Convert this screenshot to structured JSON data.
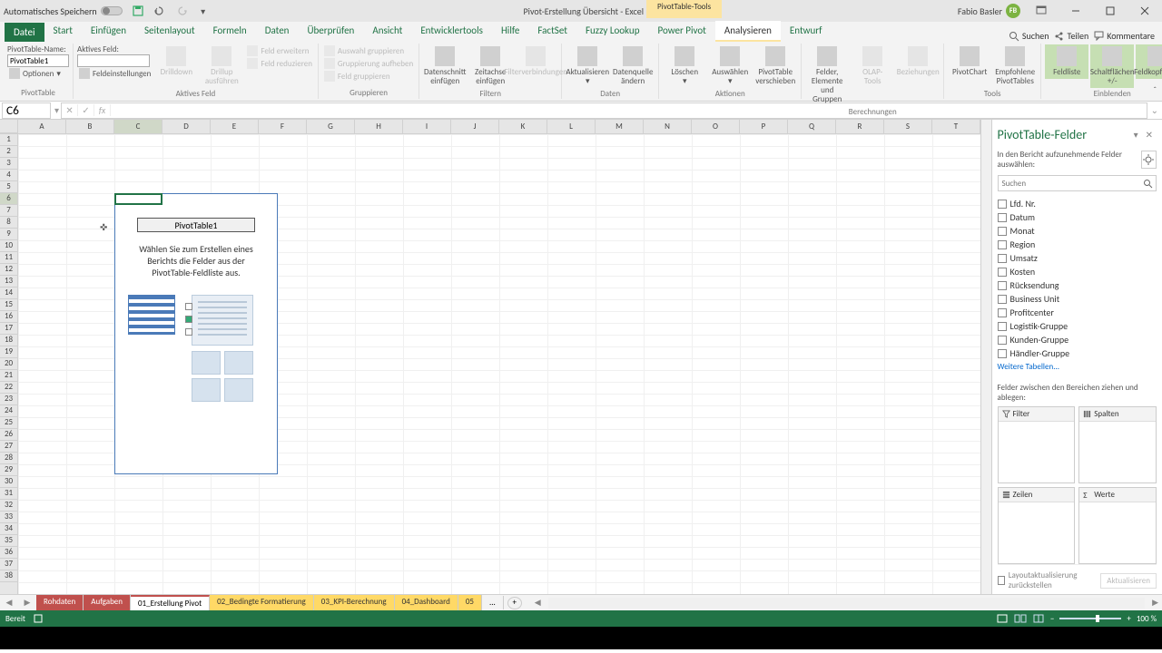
{
  "titlebar": {
    "autosave": "Automatisches Speichern",
    "document_title": "Pivot-Erstellung Übersicht  -  Excel",
    "contextual_tab": "PivotTable-Tools",
    "user_name": "Fabio Basler",
    "user_initials": "FB"
  },
  "tabs": {
    "file": "Datei",
    "items": [
      "Start",
      "Einfügen",
      "Seitenlayout",
      "Formeln",
      "Daten",
      "Überprüfen",
      "Ansicht",
      "Entwicklertools",
      "Hilfe",
      "FactSet",
      "Fuzzy Lookup",
      "Power Pivot",
      "Analysieren",
      "Entwurf"
    ],
    "active_index": 12,
    "search_placeholder": "Suchen",
    "share": "Teilen",
    "comments": "Kommentare"
  },
  "ribbon": {
    "pivottable": {
      "name_label": "PivotTable-Name:",
      "name_value": "PivotTable1",
      "options": "Optionen",
      "group_label": "PivotTable"
    },
    "active_field": {
      "label": "Aktives Feld:",
      "drilldown": "Drilldown",
      "drillup": "Drillup\nausführen",
      "settings": "Feldeinstellungen",
      "expand": "Feld erweitern",
      "collapse": "Feld reduzieren",
      "group_label": "Aktives Feld"
    },
    "group": {
      "group_sel": "Auswahl gruppieren",
      "ungroup": "Gruppierung aufheben",
      "group_field": "Feld gruppieren",
      "group_label": "Gruppieren"
    },
    "filter": {
      "slicer": "Datenschnitt\neinfügen",
      "timeline": "Zeitachse\neinfügen",
      "connections": "Filterverbindungen",
      "group_label": "Filtern"
    },
    "data": {
      "refresh": "Aktualisieren",
      "change_src": "Datenquelle\nändern",
      "group_label": "Daten"
    },
    "actions": {
      "clear": "Löschen",
      "select": "Auswählen",
      "move": "PivotTable\nverschieben",
      "group_label": "Aktionen"
    },
    "calc": {
      "fields": "Felder, Elemente\nund Gruppen",
      "olap": "OLAP-\nTools",
      "relations": "Beziehungen",
      "group_label": "Berechnungen"
    },
    "tools": {
      "chart": "PivotChart",
      "recommended": "Empfohlene\nPivotTables",
      "group_label": "Tools"
    },
    "show": {
      "fieldlist": "Feldliste",
      "buttons": "Schaltflächen\n+/-",
      "headers": "Feldkopfzeilen",
      "group_label": "Einblenden"
    }
  },
  "namebox": "C6",
  "columns": [
    "A",
    "B",
    "C",
    "D",
    "E",
    "F",
    "G",
    "H",
    "I",
    "J",
    "K",
    "L",
    "M",
    "N",
    "O",
    "P",
    "Q",
    "R",
    "S",
    "T"
  ],
  "pivot_placeholder": {
    "name": "PivotTable1",
    "hint1": "Wählen Sie zum Erstellen eines",
    "hint2": "Berichts die Felder aus der",
    "hint3": "PivotTable-Feldliste aus."
  },
  "fieldpane": {
    "title": "PivotTable-Felder",
    "desc": "In den Bericht aufzunehmende Felder auswählen:",
    "search_placeholder": "Suchen",
    "fields": [
      "Lfd. Nr.",
      "Datum",
      "Monat",
      "Region",
      "Umsatz",
      "Kosten",
      "Rücksendung",
      "Business Unit",
      "Profitcenter",
      "Logistik-Gruppe",
      "Kunden-Gruppe",
      "Händler-Gruppe"
    ],
    "more": "Weitere Tabellen...",
    "areas_label": "Felder zwischen den Bereichen ziehen und ablegen:",
    "filter": "Filter",
    "columns": "Spalten",
    "rows": "Zeilen",
    "values": "Werte",
    "defer": "Layoutaktualisierung zurückstellen",
    "update": "Aktualisieren"
  },
  "sheets": {
    "tabs": [
      {
        "label": "Rohdaten",
        "cls": "red"
      },
      {
        "label": "Aufgaben",
        "cls": "red"
      },
      {
        "label": "01_Erstellung Pivot",
        "cls": "active"
      },
      {
        "label": "02_Bedingte Formatierung",
        "cls": "yellow"
      },
      {
        "label": "03_KPI-Berechnung",
        "cls": "yellow"
      },
      {
        "label": "04_Dashboard",
        "cls": "yellow"
      },
      {
        "label": "05",
        "cls": "yellow"
      }
    ],
    "overflow": "..."
  },
  "statusbar": {
    "ready": "Bereit",
    "zoom": "100 %"
  }
}
